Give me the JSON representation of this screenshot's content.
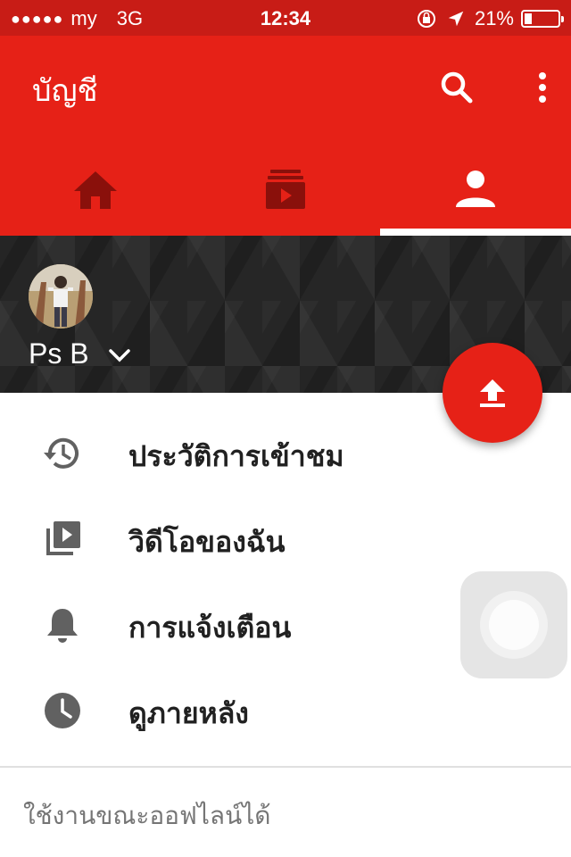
{
  "status_bar": {
    "signal": "●●●●●",
    "carrier": "my",
    "network": "3G",
    "time": "12:34",
    "battery_percent": "21%",
    "battery_level": 0.21
  },
  "app_bar": {
    "title": "บัญชี",
    "search_icon": "search-icon",
    "menu_icon": "more-vert-icon",
    "background_color": "#e62117"
  },
  "tabs": [
    {
      "icon": "home-icon",
      "selected": false
    },
    {
      "icon": "subscriptions-icon",
      "selected": false
    },
    {
      "icon": "account-icon",
      "selected": true
    }
  ],
  "profile": {
    "name": "Ps B",
    "dropdown_icon": "chevron-down-icon"
  },
  "fab": {
    "icon": "upload-icon"
  },
  "menu": [
    {
      "icon": "history-icon",
      "label": "ประวัติการเข้าชม"
    },
    {
      "icon": "my-videos-icon",
      "label": "วิดีโอของฉัน"
    },
    {
      "icon": "bell-icon",
      "label": "การแจ้งเตือน"
    },
    {
      "icon": "clock-icon",
      "label": "ดูภายหลัง"
    }
  ],
  "section": {
    "header": "ใช้งานขณะออฟไลน์ได้"
  }
}
